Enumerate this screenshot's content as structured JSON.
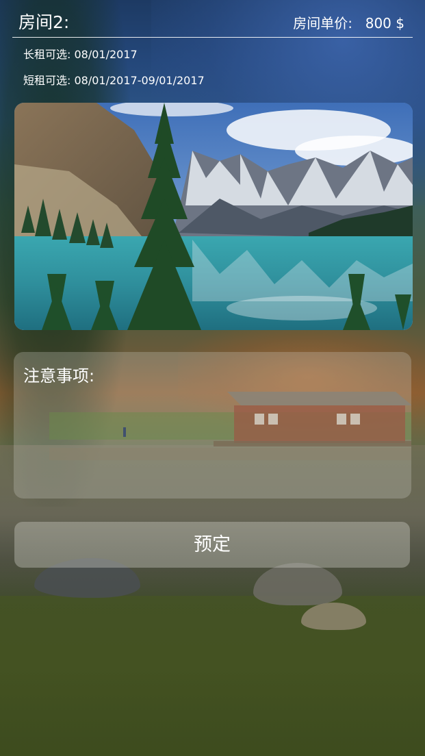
{
  "room": {
    "title": "房间2:",
    "price_label": "房间单价:",
    "price_value": "800 $"
  },
  "availability": {
    "long_term_label": "长租可选:",
    "long_term_value": "08/01/2017",
    "short_term_label": "短租可选:",
    "short_term_value": "08/01/2017-09/01/2017"
  },
  "photo": {
    "subject": "mountain lake with pine trees"
  },
  "notes": {
    "title": "注意事项:",
    "content": ""
  },
  "actions": {
    "reserve_label": "预定"
  },
  "colors": {
    "text": "#ffffff",
    "panel_overlay": "rgba(210,210,200,0.28)",
    "button_overlay": "rgba(220,220,212,0.35)"
  }
}
